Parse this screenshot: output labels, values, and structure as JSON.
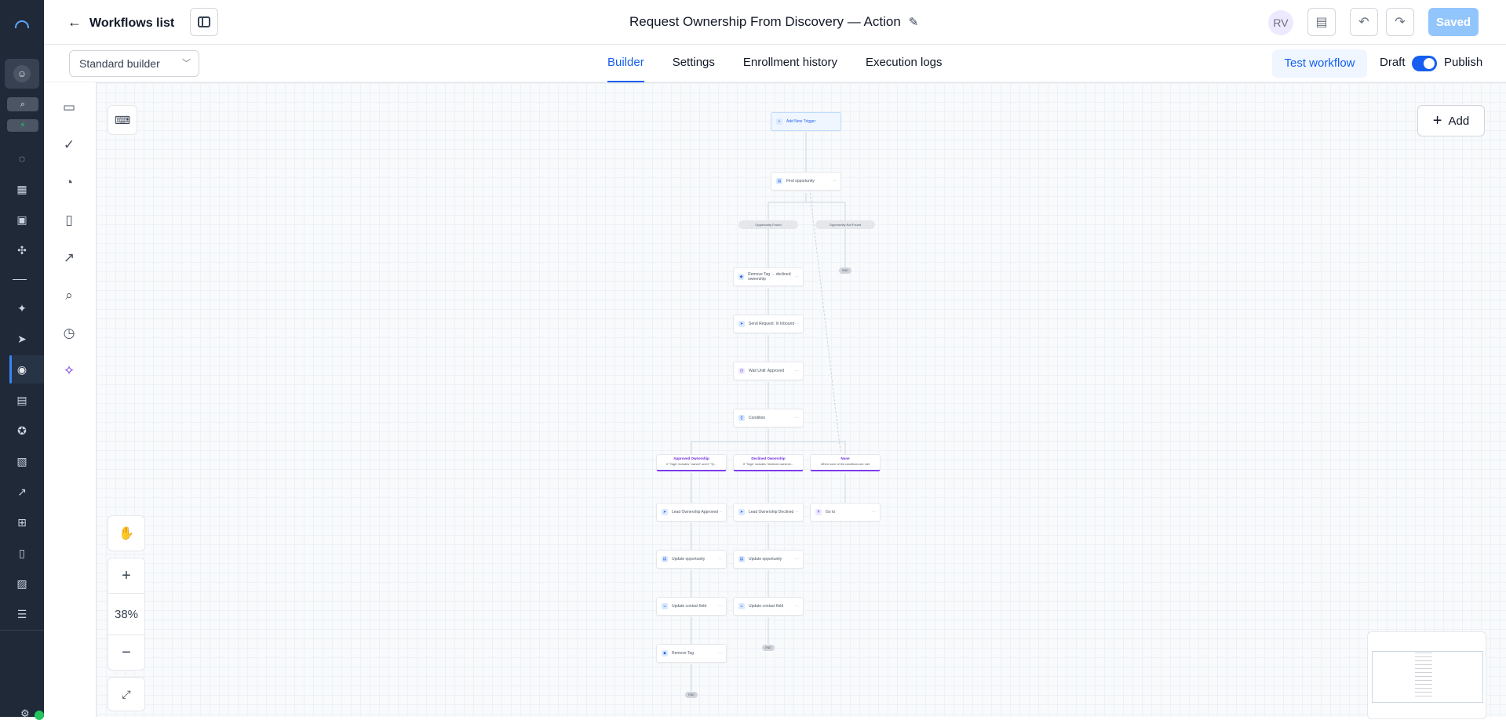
{
  "header": {
    "back_label": "Workflows list",
    "title": "Request Ownership From Discovery — Action",
    "avatar_initials": "RV",
    "saved_label": "Saved"
  },
  "subheader": {
    "builder_select": "Standard builder",
    "tabs": [
      {
        "label": "Builder",
        "active": true
      },
      {
        "label": "Settings",
        "active": false
      },
      {
        "label": "Enrollment history",
        "active": false
      },
      {
        "label": "Execution logs",
        "active": false
      }
    ],
    "test_workflow": "Test workflow",
    "draft_label": "Draft",
    "publish_label": "Publish",
    "publish_toggle_on": true
  },
  "canvas": {
    "add_label": "Add",
    "zoom": "38%"
  },
  "workflow": {
    "trigger": "Add New Trigger",
    "find_opportunity": "Find opportunity",
    "branch_found": "Opportunity Found",
    "branch_not_found": "Opportunity Not Found",
    "end_label": "END",
    "steps": {
      "remove_tag_declined": "Remove Tag → declined ownership",
      "send_request": "Send Request: In Inbound",
      "wait_approved": "Wait Until: Approved",
      "condition": "Condition"
    },
    "branches": [
      {
        "title": "Approved Ownership",
        "sub": "If \"Tags\" includes \"owned\" and if \"Ty..."
      },
      {
        "title": "Declined Ownership",
        "sub": "If \"Tags\" includes \"declined ownersh..."
      },
      {
        "title": "None",
        "sub": "When none of the conditions are met"
      }
    ],
    "approved_steps": [
      "Lead Ownership Approved",
      "Update opportunity",
      "Update contact field",
      "Remove Tag"
    ],
    "declined_steps": [
      "Lead Ownership Declined",
      "Update opportunity",
      "Update contact field"
    ],
    "none_steps": [
      "Go to"
    ]
  },
  "colors": {
    "accent": "#155eef",
    "rail": "#1f2937",
    "saved_button": "#93c5fd",
    "branch_purple": "#7c3aed"
  }
}
